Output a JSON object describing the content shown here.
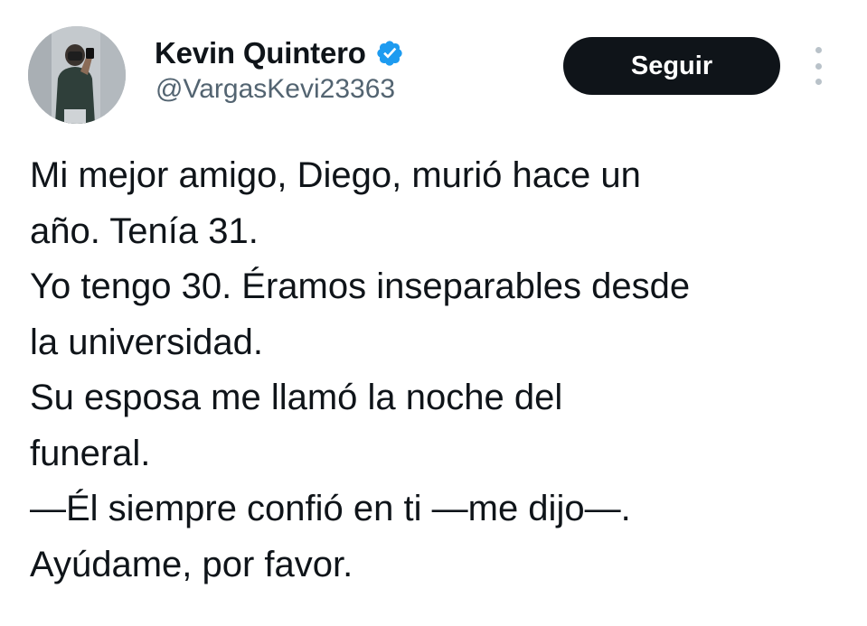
{
  "tweet": {
    "author": {
      "display_name": "Kevin Quintero",
      "handle": "@VargasKevi23363",
      "verified": true
    },
    "follow_label": "Seguir",
    "text_lines": [
      "Mi mejor amigo, Diego, murió hace un",
      "año. Tenía 31.",
      "Yo tengo 30. Éramos inseparables desde",
      "la universidad.",
      "Su esposa me llamó la noche del",
      "funeral.",
      "—Él siempre confió en ti —me dijo—.",
      "Ayúdame, por favor."
    ]
  },
  "icons": {
    "verified": "verified-badge-icon",
    "more": "more-options-icon"
  },
  "colors": {
    "text_primary": "#0f1419",
    "text_secondary": "#536471",
    "verified_blue": "#1d9bf0",
    "button_bg": "#0f1419",
    "button_text": "#ffffff"
  }
}
